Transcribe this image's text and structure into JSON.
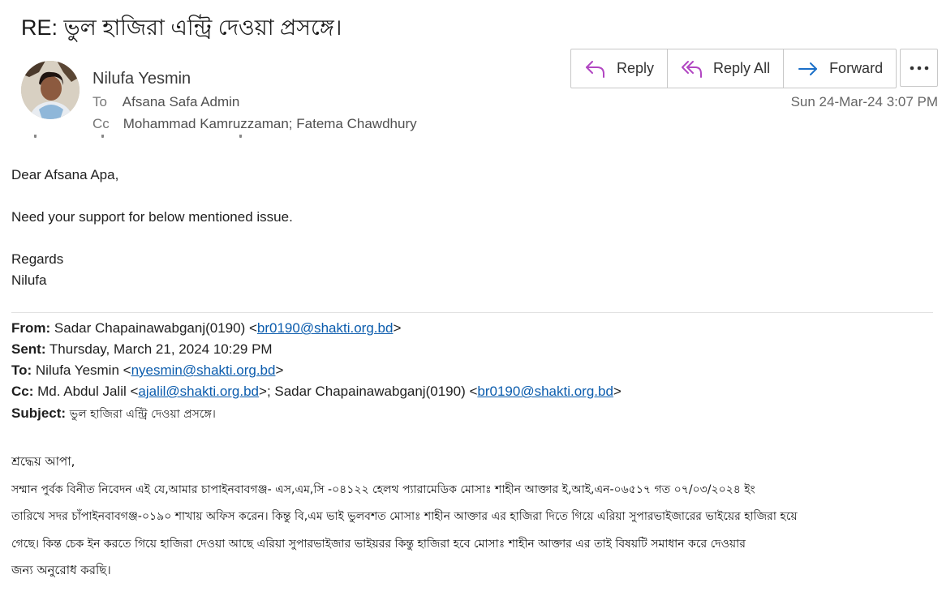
{
  "email": {
    "subject": "RE: ভুল হাজিরা এন্ট্রি দেওয়া প্রসঙ্গে।",
    "sender_name": "Nilufa Yesmin",
    "to_label": "To",
    "to_value": "Afsana Safa Admin",
    "cc_label": "Cc",
    "cc_value": "Mohammad  Kamruzzaman; Fatema Chawdhury",
    "date": "Sun 24-Mar-24 3:07 PM"
  },
  "actions": {
    "reply": "Reply",
    "reply_all": "Reply All",
    "forward": "Forward"
  },
  "body": {
    "greeting": "Dear Afsana Apa,",
    "line1": "Need your support for below mentioned issue.",
    "regards": "Regards",
    "signature": "Nilufa"
  },
  "forwarded": {
    "from_label": "From:",
    "from_name": "Sadar Chapainawabganj(0190) <",
    "from_email": "br0190@shakti.org.bd",
    "from_tail": ">",
    "sent_label": "Sent:",
    "sent_value": "Thursday, March 21, 2024 10:29 PM",
    "to_label": "To:",
    "to_name": "Nilufa Yesmin <",
    "to_email": "nyesmin@shakti.org.bd",
    "to_tail": ">",
    "cc_label": "Cc:",
    "cc_name1": "Md. Abdul Jalil <",
    "cc_email1": "ajalil@shakti.org.bd",
    "cc_mid": ">; Sadar Chapainawabganj(0190) <",
    "cc_email2": "br0190@shakti.org.bd",
    "cc_tail": ">",
    "subject_label": "Subject:",
    "subject_value": "ভুল  হাজিরা  এন্ট্রি  দেওয়া  প্রসঙ্গে।"
  },
  "bangla_body": {
    "salutation": "শ্রদ্ধেয়  আপা,",
    "line1": "সম্মান  পুর্বক  বিনীত  নিবেদন  এই  যে,আমার  চাপাইনবাবগঞ্জ- এস,এম,সি -০৪১২২    হেলথ প্যারামেডিক মোসাঃ শাহীন আক্তার ই,আই,এন-০৬৫১৭  গত ০৭/০৩/২০২৪ ইং",
    "line2": "তারিখে  সদর চাঁপাইনবাবগঞ্জ-০১৯০ শাখায় অফিস করেন। কিন্তু  বি,এম  ভাই  ভুলবশত মোসাঃ শাহীন আক্তার  এর হাজিরা দিতে গিয়ে এরিয়া  সুপারভাইজারের  ভাইয়ের হাজিরা  হয়ে",
    "line3": "গেছে।  কিন্ত  চেক  ইন  করতে  গিয়ে  হাজিরা  দেওয়া  আছে  এরিয়া  সুপারভাইজার   ভাইয়রর কিন্তু হাজিরা হবে মোসাঃ শাহীন আক্তার  এর তাই বিষয়টি সমাধান করে  দেওয়ার",
    "line4": "জন্য  অনুরোধ  করছি।"
  },
  "icons": {
    "reply": "reply-arrow-icon",
    "reply_all": "reply-all-arrow-icon",
    "forward": "forward-arrow-icon",
    "more": "more-dots-icon",
    "avatar": "avatar-photo"
  },
  "colors": {
    "reply_icon": "#b146c2",
    "forward_icon": "#1b6fc8",
    "link": "#0b5cad"
  }
}
